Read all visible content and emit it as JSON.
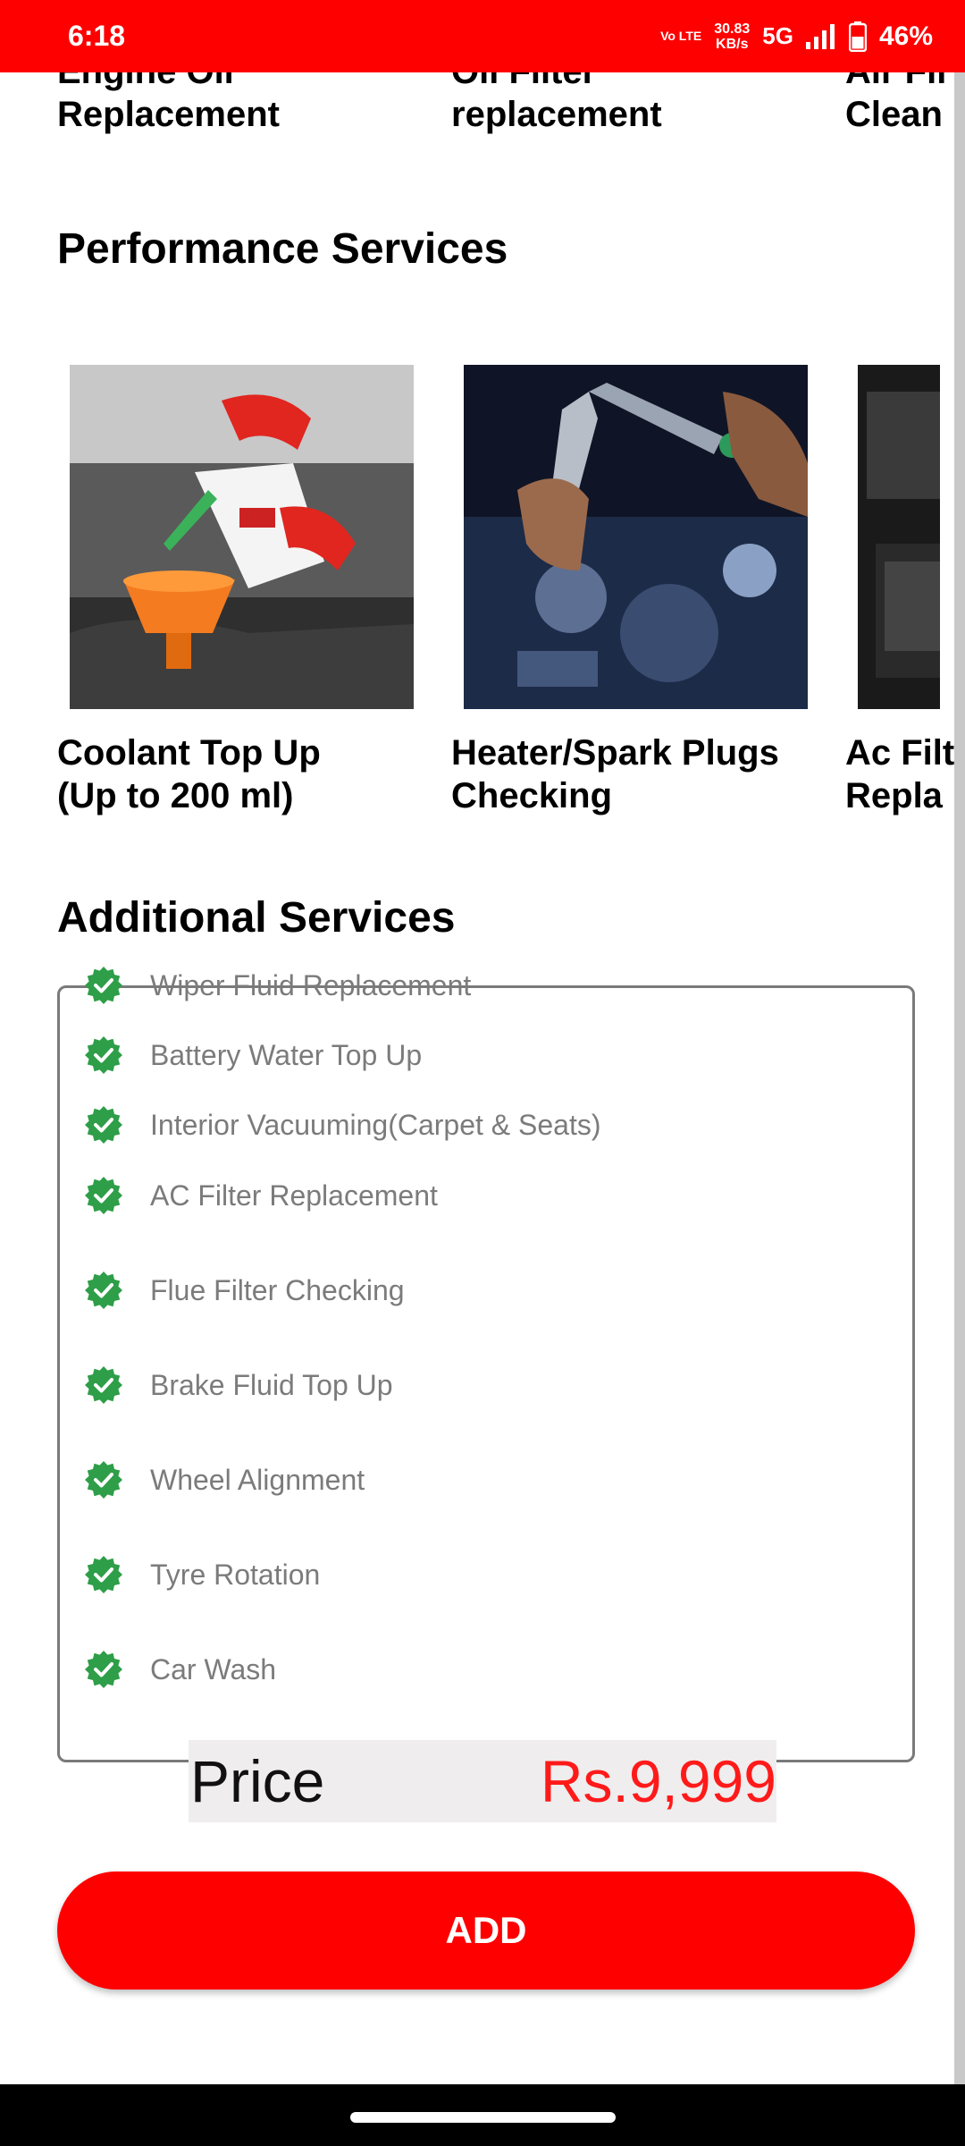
{
  "status_bar": {
    "time": "6:18",
    "volte": "Vo LTE",
    "net_speed_value": "30.83",
    "net_speed_unit": "KB/s",
    "network": "5G",
    "battery": "46%"
  },
  "top_services": [
    {
      "title": "Engine Oil\nReplacement"
    },
    {
      "title": "Oil Filter\nreplacement"
    },
    {
      "title": "Air Fil\nClean"
    }
  ],
  "performance": {
    "heading": "Performance Services",
    "cards": [
      {
        "title": "Coolant Top Up\n(Up to 200 ml)",
        "image_icon": "coolant-pour-image"
      },
      {
        "title": "Heater/Spark Plugs\nChecking",
        "image_icon": "spark-plug-wrench-image"
      },
      {
        "title": "Ac Filt\nRepla",
        "image_icon": "ac-filter-image"
      }
    ]
  },
  "additional": {
    "heading": "Additional Services",
    "check_icon": "verified-badge-icon",
    "check_color": "#2e9e48",
    "items": [
      "Wiper Fluid Replacement",
      "Battery Water Top Up",
      "Interior Vacuuming(Carpet & Seats)",
      "AC Filter Replacement",
      "Flue Filter Checking",
      "Brake Fluid Top Up",
      "Wheel Alignment",
      "Tyre Rotation",
      "Car Wash"
    ]
  },
  "price": {
    "label": "Price",
    "value": "Rs.9,999",
    "value_color": "#ff1a1a"
  },
  "add_button": {
    "label": "ADD",
    "color": "#ff0000"
  }
}
